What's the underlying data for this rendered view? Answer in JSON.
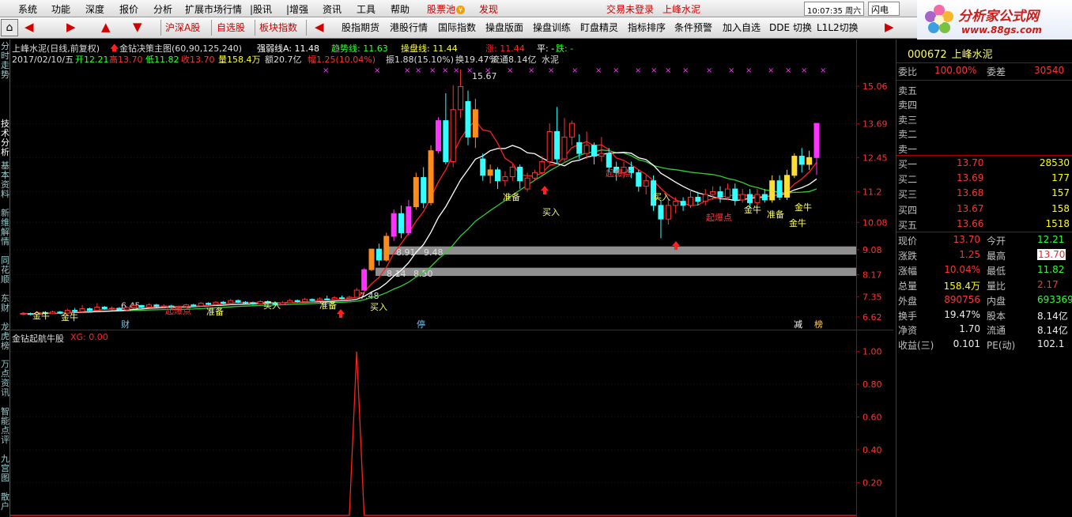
{
  "menu": {
    "items": [
      "系统",
      "功能",
      "深度",
      "报价",
      "分析",
      "扩展市场行情",
      "|股讯",
      "|增强",
      "资讯",
      "工具",
      "帮助"
    ],
    "stock_pool": "股票池",
    "discover": "发现",
    "not_logged_in": "交易未登录",
    "stock_name": "上峰水泥",
    "clock": "10:07:35 周六",
    "flash_btn": "闪电手"
  },
  "toolbar": {
    "items": [
      "沪深A股",
      "自选股",
      "板块指数",
      "股指期货",
      "港股行情",
      "国际指数",
      "操盘版面",
      "操盘训练",
      "盯盘精灵",
      "指标排序",
      "条件预警",
      "加入自选",
      "DDE 切换",
      "L1L2切换"
    ],
    "home_icon": "⌂"
  },
  "logo": {
    "title": "分析家公式网",
    "url": "www.88gs.com"
  },
  "left_tabs": [
    {
      "label": "分时走势",
      "active": false
    },
    {
      "label": "技术分析",
      "active": true
    },
    {
      "label": "基本资料",
      "active": false
    },
    {
      "label": "新维解情",
      "active": false
    },
    {
      "label": "同花顺",
      "active": false
    },
    {
      "label": "东财",
      "active": false
    },
    {
      "label": "龙虎榜",
      "active": false
    },
    {
      "label": "万点资讯",
      "active": false
    },
    {
      "label": "智能点评",
      "active": false
    },
    {
      "label": "九宫图",
      "active": false
    },
    {
      "label": "散户",
      "active": false
    }
  ],
  "chart_header": {
    "line1_name": "上峰水泥(日线,前复权)",
    "line1_indicator": "金钻决策主图(60,90,125,240)",
    "line1_strong": "强弱线A: 11.48",
    "line1_trend": "趋势线: 11.63",
    "line1_op": "操盘线: 11.44",
    "line1_up": "涨: 11.44",
    "line1_flat": "平: -",
    "line1_down": "跌: -",
    "line2_date": "2017/02/10/五",
    "line2_open": "开12.21",
    "line2_high": "高13.70",
    "line2_low": "低11.82",
    "line2_close": "收13.70",
    "line2_vol": "量158.4万",
    "line2_amount": "额20.7亿",
    "line2_range": "幅1.25(10.04%)",
    "line2_swing": "振1.88(15.10%)",
    "line2_turnover": "换19.47%",
    "line2_float": "流通8.14亿",
    "line2_sector": "水泥"
  },
  "sub_header": {
    "name": "金钻起航牛股",
    "value": "XG: 0.00"
  },
  "chart_data": [
    {
      "type": "candlestick",
      "title": "上峰水泥(日线,前复权)",
      "y_ticks": [
        15.06,
        13.69,
        12.45,
        11.2,
        10.08,
        9.08,
        8.17,
        7.35,
        6.62
      ],
      "ylim": [
        6.3,
        15.9
      ],
      "high_label": "15.67",
      "candles": [
        {
          "o": 6.72,
          "c": 6.75,
          "h": 6.8,
          "l": 6.68
        },
        {
          "o": 6.74,
          "c": 6.72,
          "h": 6.78,
          "l": 6.68
        },
        {
          "o": 6.72,
          "c": 6.78,
          "h": 6.82,
          "l": 6.7
        },
        {
          "o": 6.78,
          "c": 6.74,
          "h": 6.82,
          "l": 6.7
        },
        {
          "o": 6.74,
          "c": 6.8,
          "h": 6.85,
          "l": 6.72
        },
        {
          "o": 6.8,
          "c": 6.76,
          "h": 6.84,
          "l": 6.72
        },
        {
          "o": 6.76,
          "c": 6.86,
          "h": 6.92,
          "l": 6.74
        },
        {
          "o": 6.86,
          "c": 6.82,
          "h": 6.95,
          "l": 6.78
        },
        {
          "o": 6.82,
          "c": 6.92,
          "h": 7.06,
          "l": 6.8
        },
        {
          "o": 6.92,
          "c": 6.86,
          "h": 6.96,
          "l": 6.82
        },
        {
          "o": 6.86,
          "c": 6.98,
          "h": 7.12,
          "l": 6.84
        },
        {
          "o": 6.98,
          "c": 6.92,
          "h": 7.02,
          "l": 6.88
        },
        {
          "o": 6.92,
          "c": 6.94,
          "h": 7.0,
          "l": 6.86
        },
        {
          "o": 6.94,
          "c": 6.88,
          "h": 6.98,
          "l": 6.84
        },
        {
          "o": 6.88,
          "c": 6.96,
          "h": 7.02,
          "l": 6.84
        },
        {
          "o": 6.96,
          "c": 7.04,
          "h": 7.1,
          "l": 6.92
        },
        {
          "o": 7.04,
          "c": 6.98,
          "h": 7.06,
          "l": 6.94
        },
        {
          "o": 6.98,
          "c": 7.06,
          "h": 7.12,
          "l": 6.96
        },
        {
          "o": 7.06,
          "c": 7.0,
          "h": 7.1,
          "l": 6.96
        },
        {
          "o": 7.0,
          "c": 7.02,
          "h": 7.08,
          "l": 6.96
        },
        {
          "o": 7.02,
          "c": 6.96,
          "h": 7.06,
          "l": 6.92
        },
        {
          "o": 6.96,
          "c": 7.0,
          "h": 7.04,
          "l": 6.92
        },
        {
          "o": 7.0,
          "c": 7.06,
          "h": 7.1,
          "l": 6.96
        },
        {
          "o": 7.06,
          "c": 7.02,
          "h": 7.1,
          "l": 6.98
        },
        {
          "o": 7.02,
          "c": 7.12,
          "h": 7.16,
          "l": 7.0
        },
        {
          "o": 7.12,
          "c": 7.08,
          "h": 7.16,
          "l": 7.04
        },
        {
          "o": 7.08,
          "c": 7.16,
          "h": 7.2,
          "l": 7.04
        },
        {
          "o": 7.16,
          "c": 7.12,
          "h": 7.2,
          "l": 7.08
        },
        {
          "o": 7.12,
          "c": 7.22,
          "h": 7.28,
          "l": 7.1
        },
        {
          "o": 7.22,
          "c": 7.16,
          "h": 7.26,
          "l": 7.12
        },
        {
          "o": 7.16,
          "c": 7.14,
          "h": 7.2,
          "l": 7.1
        },
        {
          "o": 7.14,
          "c": 7.1,
          "h": 7.18,
          "l": 7.06
        },
        {
          "o": 7.1,
          "c": 7.18,
          "h": 7.24,
          "l": 7.08
        },
        {
          "o": 7.18,
          "c": 7.14,
          "h": 7.22,
          "l": 7.1
        },
        {
          "o": 7.14,
          "c": 7.08,
          "h": 7.18,
          "l": 7.04
        },
        {
          "o": 7.08,
          "c": 7.14,
          "h": 7.2,
          "l": 7.06
        },
        {
          "o": 7.14,
          "c": 7.22,
          "h": 7.28,
          "l": 7.12
        },
        {
          "o": 7.22,
          "c": 7.18,
          "h": 7.26,
          "l": 7.14
        },
        {
          "o": 7.18,
          "c": 7.26,
          "h": 7.32,
          "l": 7.16
        },
        {
          "o": 7.26,
          "c": 7.22,
          "h": 7.3,
          "l": 7.18
        },
        {
          "o": 7.22,
          "c": 7.28,
          "h": 7.34,
          "l": 7.2
        },
        {
          "o": 7.28,
          "c": 7.26,
          "h": 7.4,
          "l": 7.22
        },
        {
          "o": 7.26,
          "c": 7.32,
          "h": 7.38,
          "l": 7.24
        },
        {
          "o": 7.32,
          "c": 7.3,
          "h": 7.4,
          "l": 7.26
        },
        {
          "o": 7.3,
          "c": 7.34,
          "h": 7.4,
          "l": 7.28
        },
        {
          "o": 7.34,
          "c": 7.6,
          "h": 7.68,
          "l": 7.32
        },
        {
          "o": 7.6,
          "c": 8.35,
          "h": 8.4,
          "l": 7.58
        },
        {
          "o": 8.35,
          "c": 9.1,
          "h": 9.12,
          "l": 8.3
        },
        {
          "o": 9.1,
          "c": 8.7,
          "h": 9.3,
          "l": 8.5
        },
        {
          "o": 8.7,
          "c": 9.57,
          "h": 9.7,
          "l": 8.65
        },
        {
          "o": 9.57,
          "c": 10.4,
          "h": 10.55,
          "l": 9.4
        },
        {
          "o": 10.4,
          "c": 9.7,
          "h": 10.7,
          "l": 9.5
        },
        {
          "o": 9.7,
          "c": 10.65,
          "h": 10.9,
          "l": 9.6
        },
        {
          "o": 10.65,
          "c": 11.72,
          "h": 11.9,
          "l": 10.55
        },
        {
          "o": 11.72,
          "c": 10.8,
          "h": 12.1,
          "l": 10.6
        },
        {
          "o": 10.8,
          "c": 12.7,
          "h": 12.9,
          "l": 10.7
        },
        {
          "o": 12.7,
          "c": 13.8,
          "h": 13.92,
          "l": 12.6
        },
        {
          "o": 13.8,
          "c": 12.3,
          "h": 14.8,
          "l": 12.2
        },
        {
          "o": 12.3,
          "c": 14.2,
          "h": 15.1,
          "l": 12.1
        },
        {
          "o": 14.2,
          "c": 15.05,
          "h": 15.67,
          "l": 13.9
        },
        {
          "o": 14.5,
          "c": 13.2,
          "h": 14.9,
          "l": 12.9
        },
        {
          "o": 13.2,
          "c": 14.2,
          "h": 14.6,
          "l": 12.8
        },
        {
          "o": 12.4,
          "c": 11.8,
          "h": 12.6,
          "l": 11.6
        },
        {
          "o": 11.8,
          "c": 12.0,
          "h": 12.2,
          "l": 11.5
        },
        {
          "o": 12.0,
          "c": 11.6,
          "h": 12.1,
          "l": 11.3
        },
        {
          "o": 11.6,
          "c": 11.75,
          "h": 11.95,
          "l": 11.4
        },
        {
          "o": 11.75,
          "c": 12.1,
          "h": 12.2,
          "l": 11.6
        },
        {
          "o": 12.1,
          "c": 11.6,
          "h": 12.2,
          "l": 11.3
        },
        {
          "o": 11.3,
          "c": 11.7,
          "h": 11.9,
          "l": 11.2
        },
        {
          "o": 11.7,
          "c": 11.9,
          "h": 12.0,
          "l": 11.6
        },
        {
          "o": 11.9,
          "c": 12.3,
          "h": 12.5,
          "l": 11.8
        },
        {
          "o": 12.3,
          "c": 13.4,
          "h": 13.7,
          "l": 12.2
        },
        {
          "o": 13.4,
          "c": 12.4,
          "h": 14.3,
          "l": 12.2
        },
        {
          "o": 12.4,
          "c": 13.2,
          "h": 13.9,
          "l": 12.3
        },
        {
          "o": 13.2,
          "c": 13.7,
          "h": 13.8,
          "l": 12.9
        },
        {
          "o": 13.0,
          "c": 12.6,
          "h": 13.3,
          "l": 12.4
        },
        {
          "o": 12.6,
          "c": 12.9,
          "h": 13.4,
          "l": 12.4
        },
        {
          "o": 12.9,
          "c": 12.5,
          "h": 13.0,
          "l": 12.2
        },
        {
          "o": 12.5,
          "c": 12.6,
          "h": 13.2,
          "l": 12.3
        },
        {
          "o": 12.6,
          "c": 12.1,
          "h": 12.8,
          "l": 11.9
        },
        {
          "o": 12.1,
          "c": 11.9,
          "h": 12.3,
          "l": 11.6
        },
        {
          "o": 11.9,
          "c": 12.1,
          "h": 12.3,
          "l": 11.7
        },
        {
          "o": 12.1,
          "c": 11.9,
          "h": 12.3,
          "l": 11.7
        },
        {
          "o": 11.9,
          "c": 11.4,
          "h": 12.0,
          "l": 11.2
        },
        {
          "o": 11.4,
          "c": 11.6,
          "h": 11.8,
          "l": 11.1
        },
        {
          "o": 11.6,
          "c": 10.7,
          "h": 11.8,
          "l": 10.5
        },
        {
          "o": 10.7,
          "c": 10.2,
          "h": 10.9,
          "l": 9.5
        },
        {
          "o": 10.2,
          "c": 10.7,
          "h": 10.9,
          "l": 10.0
        },
        {
          "o": 10.7,
          "c": 10.85,
          "h": 11.0,
          "l": 10.4
        },
        {
          "o": 10.85,
          "c": 10.7,
          "h": 11.0,
          "l": 10.5
        },
        {
          "o": 10.7,
          "c": 11.0,
          "h": 11.3,
          "l": 10.6
        },
        {
          "o": 11.0,
          "c": 10.85,
          "h": 11.2,
          "l": 10.7
        },
        {
          "o": 10.85,
          "c": 11.1,
          "h": 11.3,
          "l": 10.7
        },
        {
          "o": 11.1,
          "c": 11.2,
          "h": 11.4,
          "l": 10.9
        },
        {
          "o": 11.2,
          "c": 11.0,
          "h": 11.4,
          "l": 10.8
        },
        {
          "o": 11.0,
          "c": 11.3,
          "h": 11.5,
          "l": 10.9
        },
        {
          "o": 11.3,
          "c": 10.9,
          "h": 11.5,
          "l": 10.7
        },
        {
          "o": 10.9,
          "c": 11.1,
          "h": 11.3,
          "l": 10.8
        },
        {
          "o": 11.1,
          "c": 10.8,
          "h": 11.3,
          "l": 10.6
        },
        {
          "o": 10.8,
          "c": 11.1,
          "h": 11.3,
          "l": 10.7
        },
        {
          "o": 11.1,
          "c": 10.9,
          "h": 11.3,
          "l": 10.8
        },
        {
          "o": 10.9,
          "c": 11.6,
          "h": 11.8,
          "l": 10.8
        },
        {
          "o": 11.6,
          "c": 11.0,
          "h": 11.8,
          "l": 10.9
        },
        {
          "o": 11.0,
          "c": 11.8,
          "h": 12.0,
          "l": 10.9
        },
        {
          "o": 11.8,
          "c": 12.5,
          "h": 12.6,
          "l": 11.7
        },
        {
          "o": 12.5,
          "c": 12.2,
          "h": 12.8,
          "l": 11.9
        },
        {
          "o": 12.2,
          "c": 12.45,
          "h": 12.7,
          "l": 12.0
        },
        {
          "o": 12.45,
          "c": 13.7,
          "h": 13.7,
          "l": 11.82
        }
      ],
      "annotations": [
        "金牛",
        "金牛",
        "起爆点",
        "准备",
        "买入",
        "准备",
        "买入",
        "准备",
        "买入",
        "起爆点",
        "买入",
        "起爆点",
        "金牛",
        "准备",
        "金牛",
        "金牛"
      ],
      "bottom_labels": [
        "财",
        "停",
        "减",
        "榜"
      ],
      "range_texts": [
        "8.91",
        "9.48",
        "8.14",
        "8.50",
        "6.45",
        "7.48"
      ]
    },
    {
      "type": "line",
      "title": "金钻起航牛股",
      "y_ticks": [
        "1.00",
        "0.80",
        "0.60",
        "0.40",
        "0.20"
      ],
      "ylim": [
        0,
        1.08
      ],
      "signal_index": 45
    }
  ],
  "quote": {
    "code": "000672",
    "name": "上峰水泥",
    "wb_label": "委比",
    "wb_value": "100.00%",
    "wc_label": "委差",
    "wc_value": "30540",
    "sells": [
      {
        "label": "卖五",
        "price": "",
        "vol": ""
      },
      {
        "label": "卖四",
        "price": "",
        "vol": ""
      },
      {
        "label": "卖三",
        "price": "",
        "vol": ""
      },
      {
        "label": "卖二",
        "price": "",
        "vol": ""
      },
      {
        "label": "卖一",
        "price": "",
        "vol": ""
      }
    ],
    "buys": [
      {
        "label": "买一",
        "price": "13.70",
        "vol": "28530"
      },
      {
        "label": "买二",
        "price": "13.69",
        "vol": "177"
      },
      {
        "label": "买三",
        "price": "13.68",
        "vol": "157"
      },
      {
        "label": "买四",
        "price": "13.67",
        "vol": "158"
      },
      {
        "label": "买五",
        "price": "13.66",
        "vol": "1518"
      }
    ],
    "stats": [
      {
        "l1": "现价",
        "v1": "13.70",
        "c1": "red",
        "l2": "今开",
        "v2": "12.21",
        "c2": "green",
        "hi2": false
      },
      {
        "l1": "涨跌",
        "v1": "1.25",
        "c1": "red",
        "l2": "最高",
        "v2": "13.70",
        "c2": "red",
        "hi2": true
      },
      {
        "l1": "涨幅",
        "v1": "10.04%",
        "c1": "red",
        "l2": "最低",
        "v2": "11.82",
        "c2": "green",
        "hi2": false
      },
      {
        "l1": "总量",
        "v1": "158.4万",
        "c1": "yellow",
        "l2": "量比",
        "v2": "2.17",
        "c2": "red",
        "hi2": false
      },
      {
        "l1": "外盘",
        "v1": "890756",
        "c1": "red",
        "l2": "内盘",
        "v2": "693369",
        "c2": "green",
        "hi2": false
      },
      {
        "l1": "换手",
        "v1": "19.47%",
        "c1": "white",
        "l2": "股本",
        "v2": "8.14亿",
        "c2": "white",
        "hi2": false
      },
      {
        "l1": "净资",
        "v1": "1.70",
        "c1": "white",
        "l2": "流通",
        "v2": "8.14亿",
        "c2": "white",
        "hi2": false
      },
      {
        "l1": "收益(三)",
        "v1": "0.101",
        "c1": "white",
        "l2": "PE(动)",
        "v2": "102.1",
        "c2": "white",
        "hi2": false
      }
    ]
  },
  "colors": {
    "up": "#ff3333",
    "down": "#33ffff",
    "signal_magenta": "#ff33ff",
    "signal_orange": "#ff8c1a",
    "ma_white": "#ffffff",
    "ma_green": "#33cc33",
    "ma_red": "#ff2020"
  }
}
